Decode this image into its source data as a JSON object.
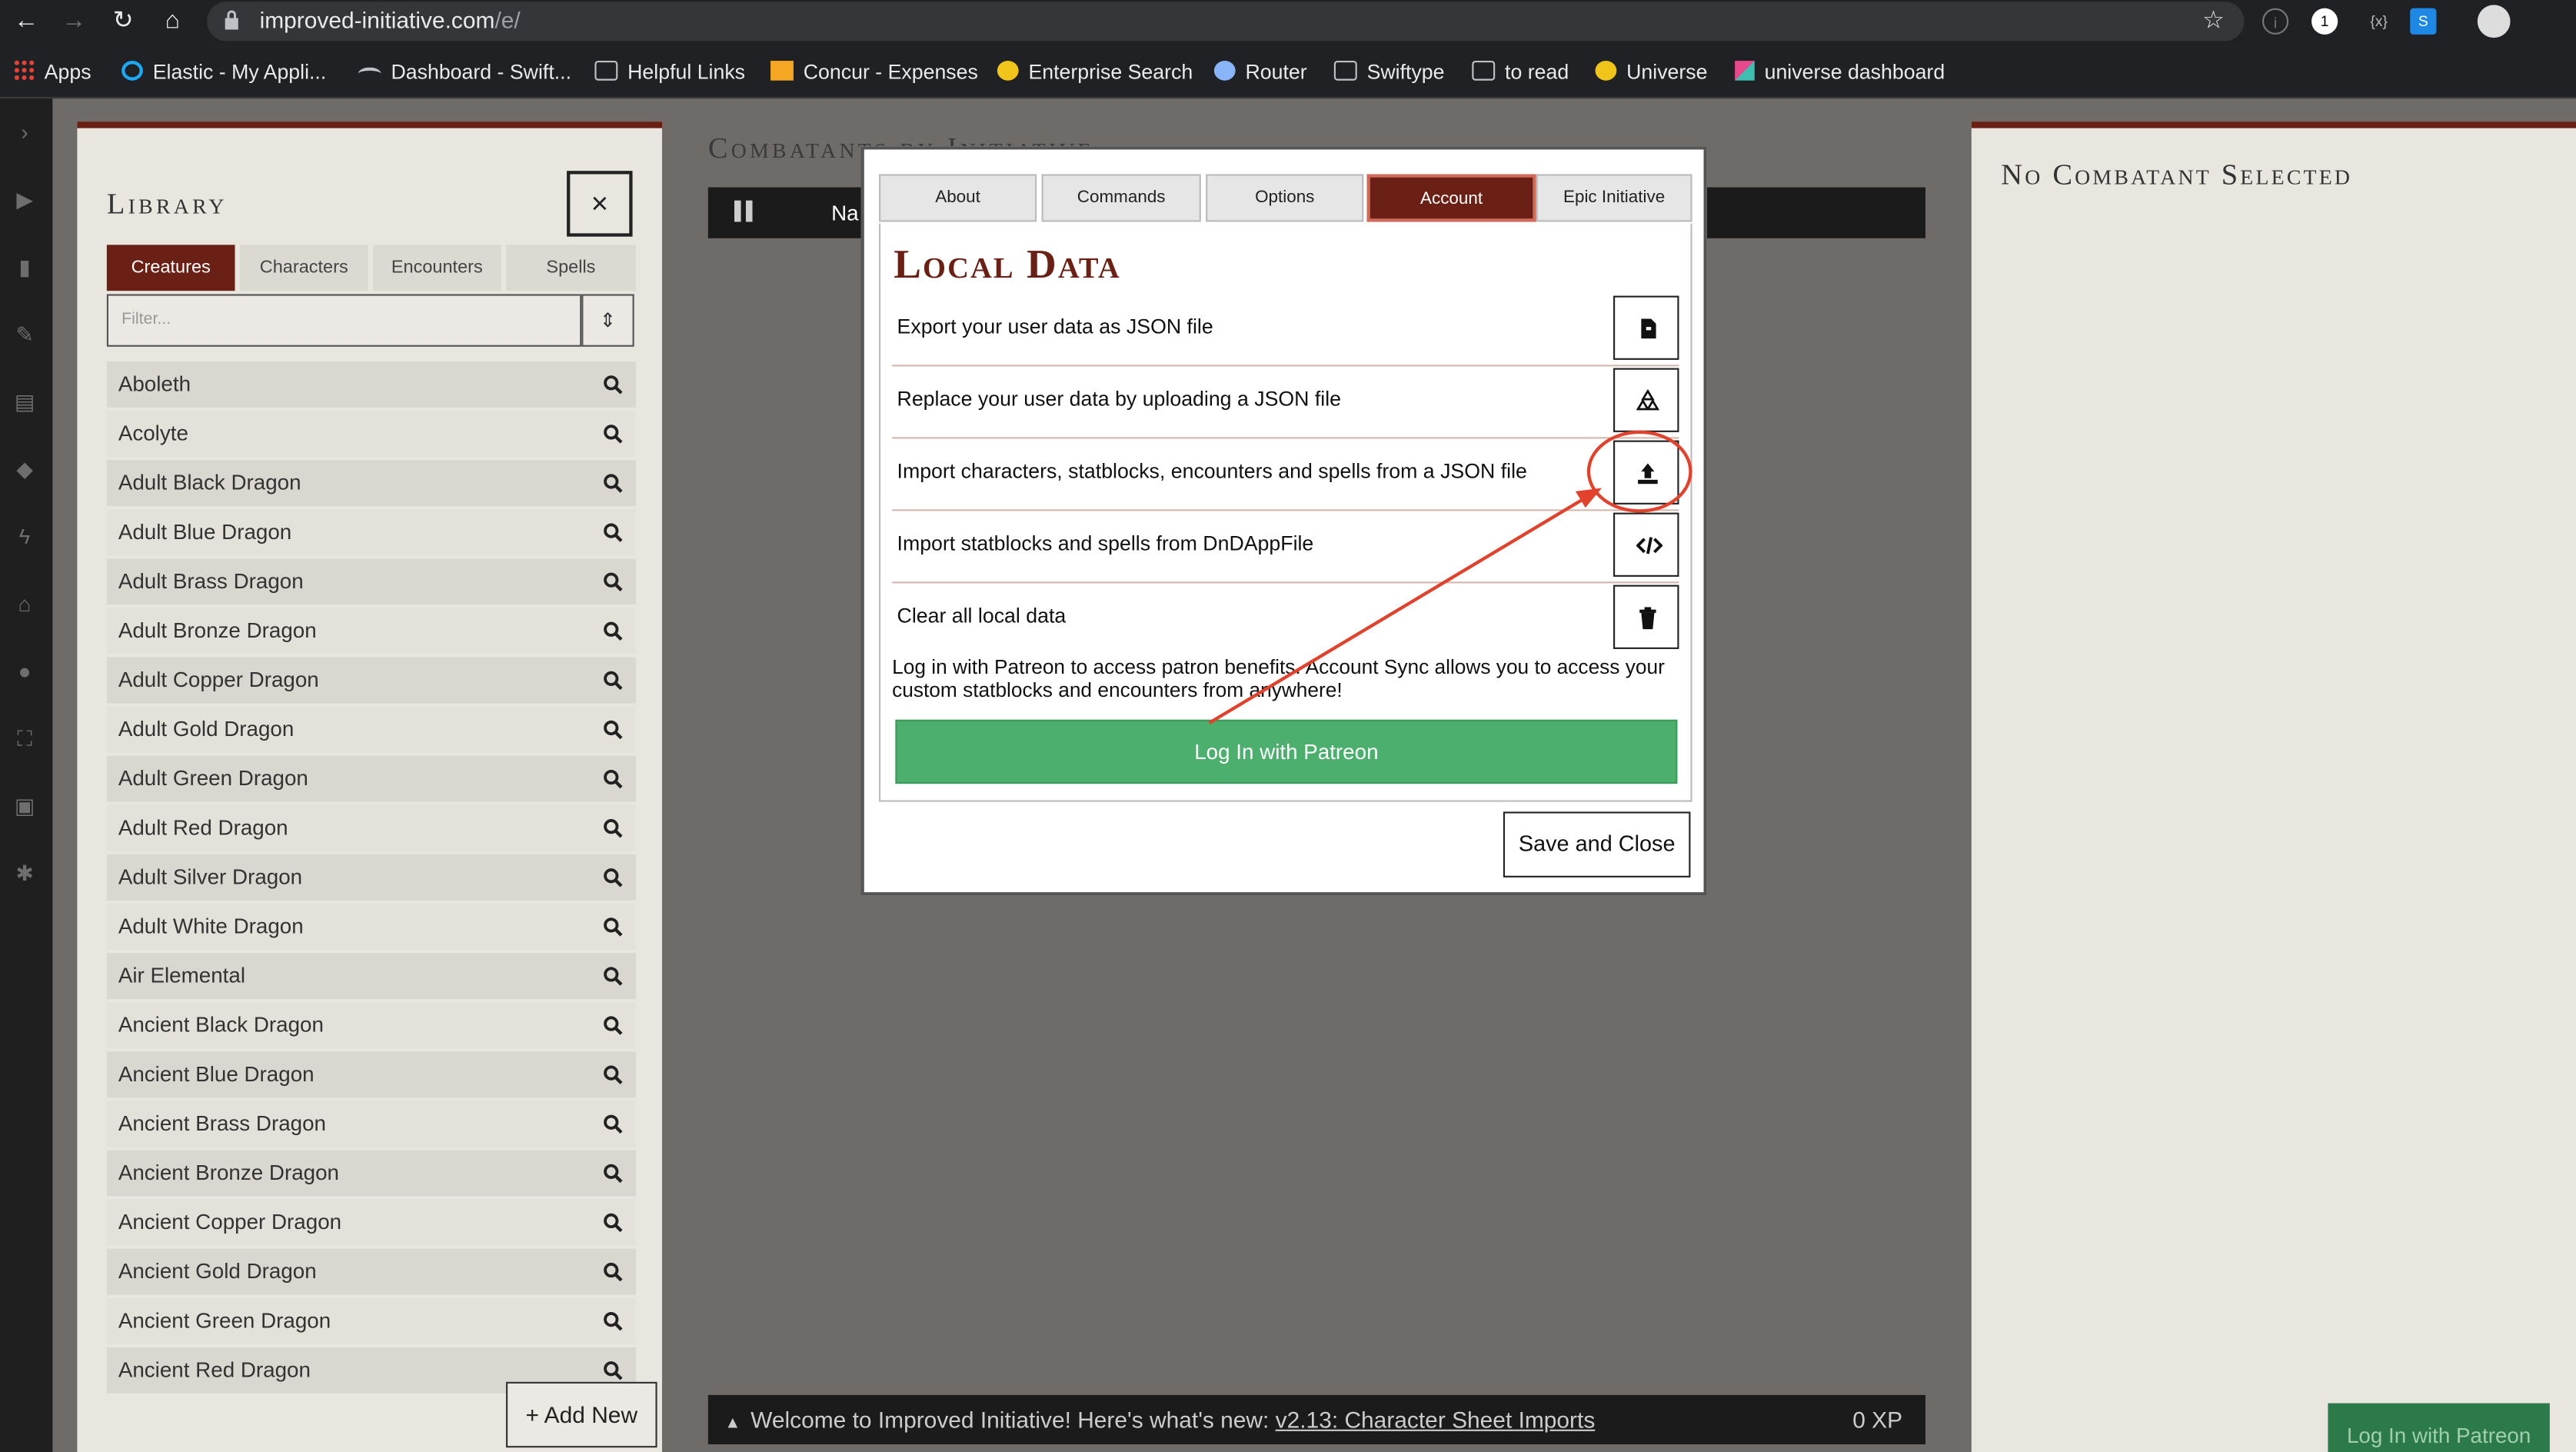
{
  "browser": {
    "url_host": "improved-initiative.com",
    "url_path": "/e/",
    "bookmarks": [
      {
        "label": "Apps"
      },
      {
        "label": "Elastic - My Appli..."
      },
      {
        "label": "Dashboard - Swift..."
      },
      {
        "label": "Helpful Links"
      },
      {
        "label": "Concur - Expenses"
      },
      {
        "label": "Enterprise Search"
      },
      {
        "label": "Router"
      },
      {
        "label": "Swiftype"
      },
      {
        "label": "to read"
      },
      {
        "label": "Universe"
      },
      {
        "label": "universe dashboard"
      }
    ],
    "ext_badges": [
      "1",
      "{x}",
      "S"
    ]
  },
  "library": {
    "title": "Library",
    "close": "×",
    "tabs": [
      "Creatures",
      "Characters",
      "Encounters",
      "Spells"
    ],
    "active_tab": "Creatures",
    "filter_placeholder": "Filter...",
    "items": [
      "Aboleth",
      "Acolyte",
      "Adult Black Dragon",
      "Adult Blue Dragon",
      "Adult Brass Dragon",
      "Adult Bronze Dragon",
      "Adult Copper Dragon",
      "Adult Gold Dragon",
      "Adult Green Dragon",
      "Adult Red Dragon",
      "Adult Silver Dragon",
      "Adult White Dragon",
      "Air Elemental",
      "Ancient Black Dragon",
      "Ancient Blue Dragon",
      "Ancient Brass Dragon",
      "Ancient Bronze Dragon",
      "Ancient Copper Dragon",
      "Ancient Gold Dragon",
      "Ancient Green Dragon",
      "Ancient Red Dragon"
    ],
    "add_new": "+ Add New"
  },
  "center": {
    "title": "Combatants by Initiative",
    "bar_label": "Na",
    "welcome_text": "Welcome to Improved Initiative! Here's what's new:",
    "welcome_link": "v2.13: Character Sheet Imports",
    "xp": "0 XP"
  },
  "right": {
    "title": "No Combatant Selected",
    "corner_button": "Log In with Patreon"
  },
  "modal": {
    "tabs": [
      "About",
      "Commands",
      "Options",
      "Account",
      "Epic Initiative"
    ],
    "active_tab": "Account",
    "section_title": "Local Data",
    "rows": [
      {
        "label": "Export your user data as JSON file",
        "icon": "file-export-icon"
      },
      {
        "label": "Replace your user data by uploading a JSON file",
        "icon": "recycle-icon"
      },
      {
        "label": "Import characters, statblocks, encounters and spells from a JSON file",
        "icon": "upload-icon"
      },
      {
        "label": "Import statblocks and spells from DnDAppFile",
        "icon": "code-icon"
      },
      {
        "label": "Clear all local data",
        "icon": "trash-icon"
      }
    ],
    "patreon_text": "Log in with Patreon to access patron benefits. Account Sync allows you to access your custom statblocks and encounters from anywhere!",
    "patreon_button": "Log In with Patreon",
    "save_close": "Save and Close"
  },
  "annotation": {
    "color": "#e2412b",
    "target": "upload-icon"
  }
}
